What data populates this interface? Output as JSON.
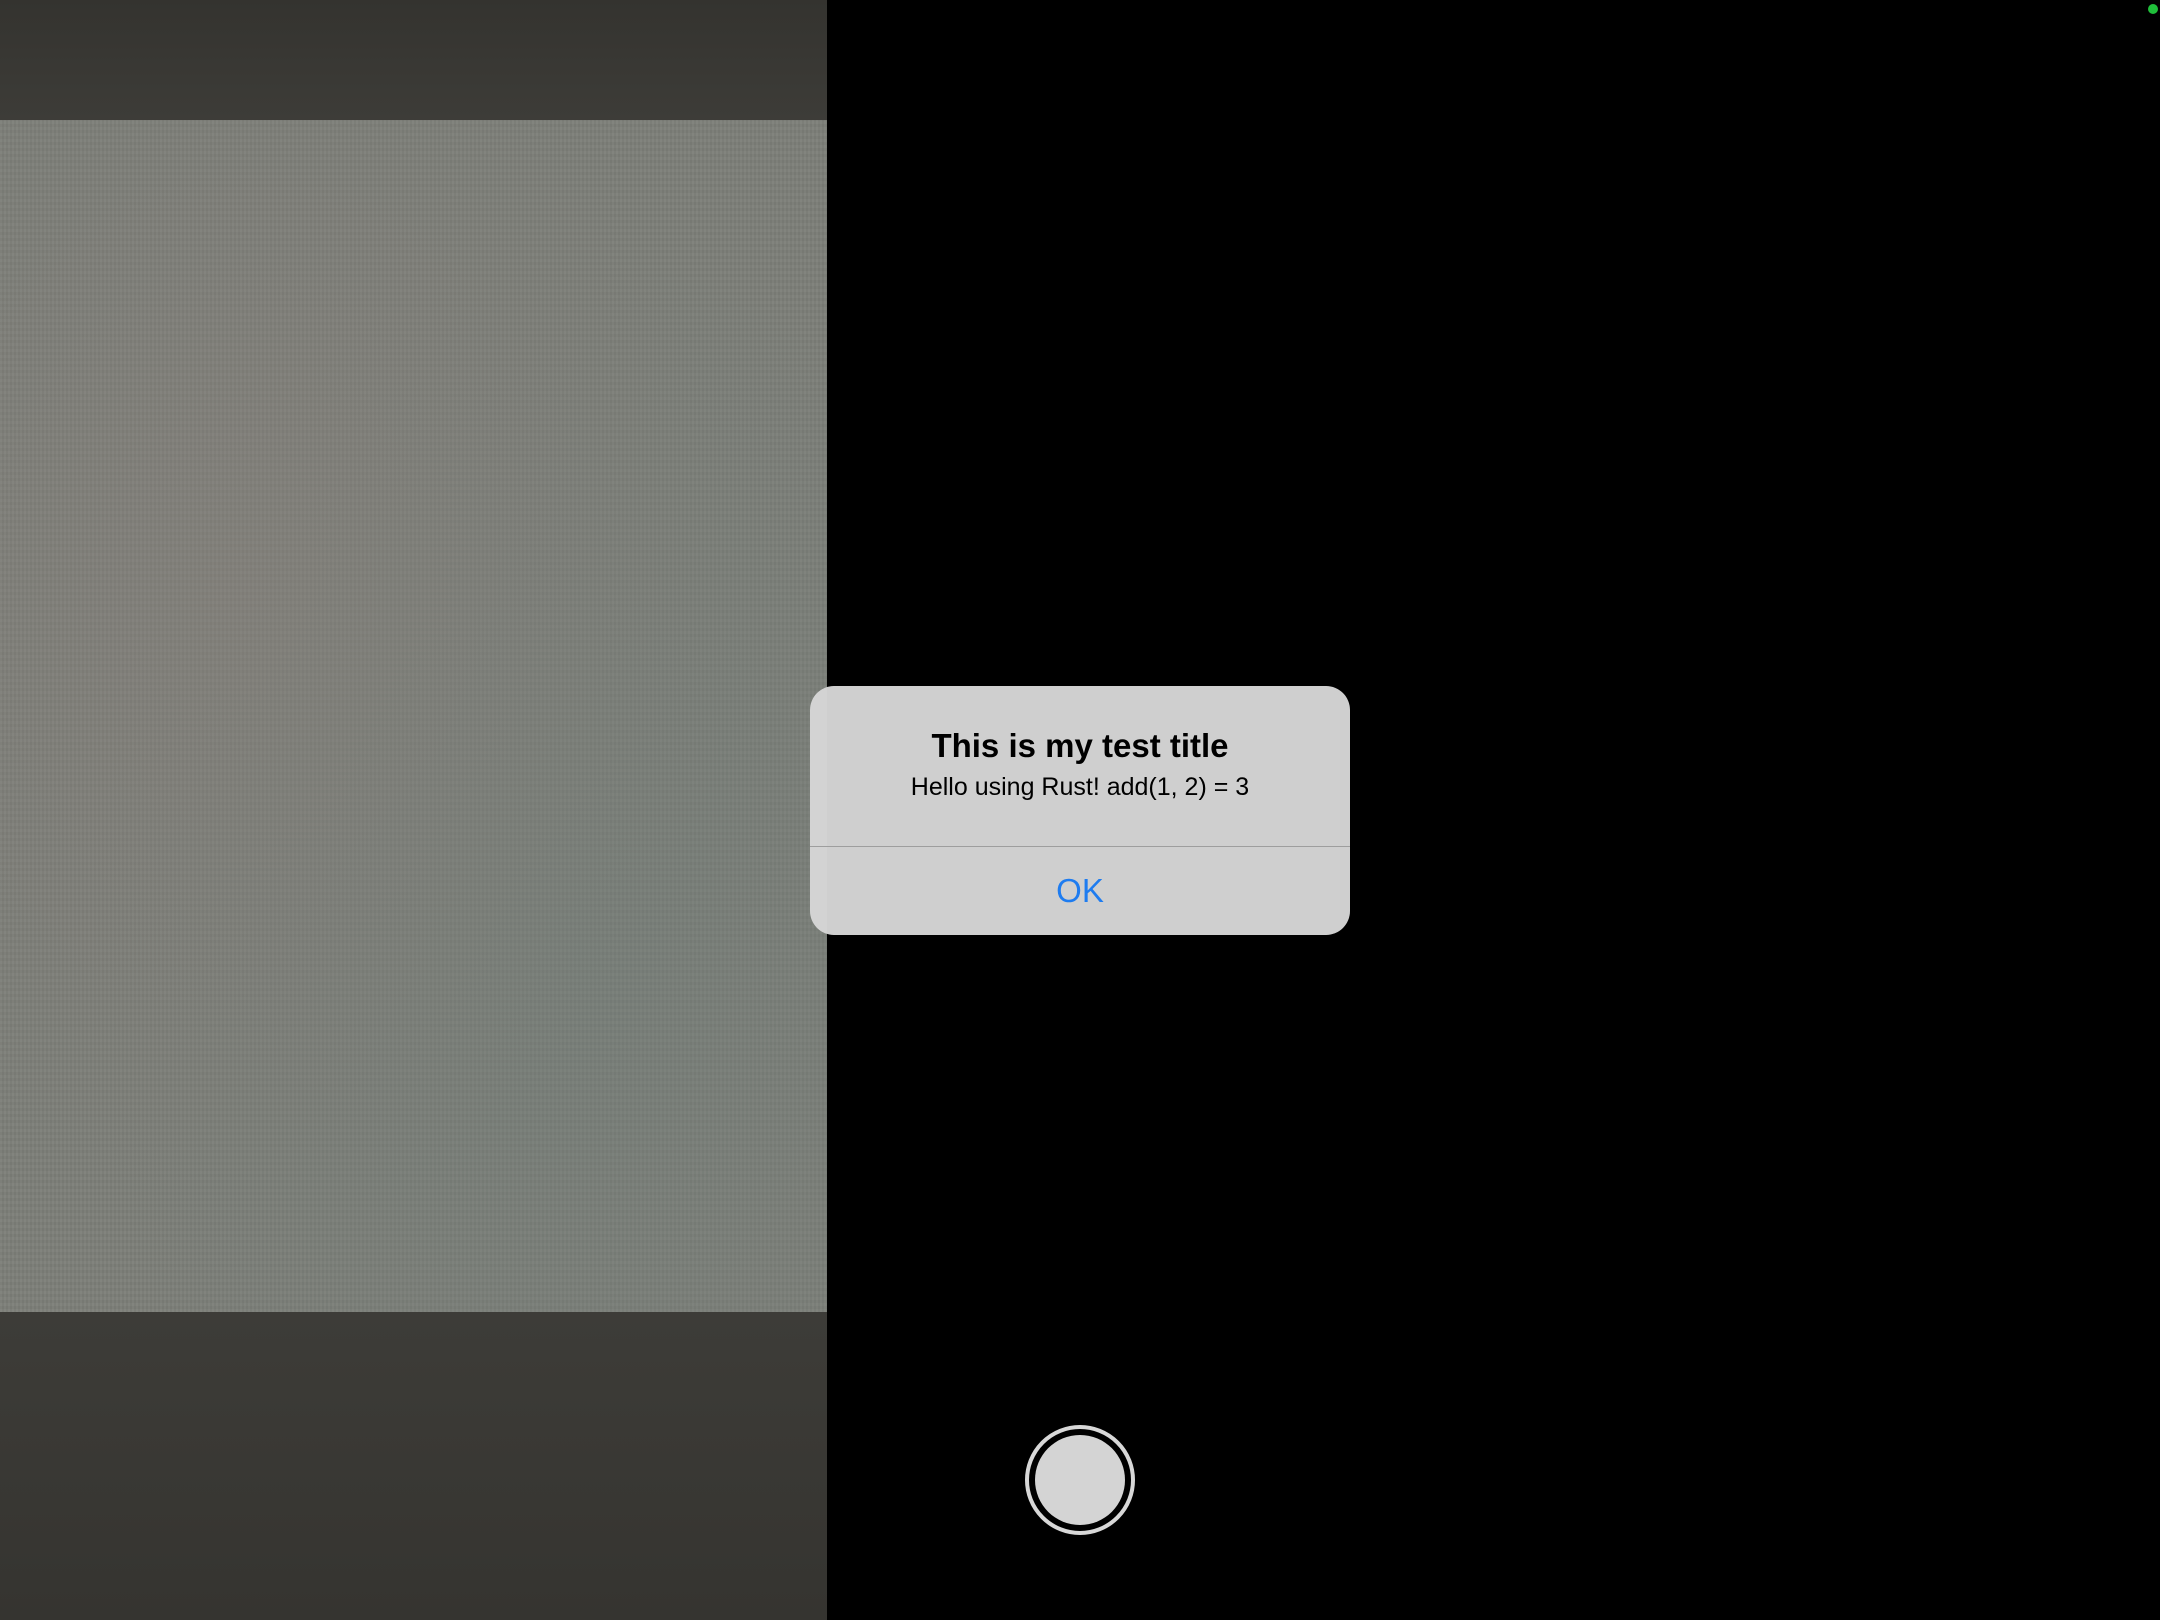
{
  "alert": {
    "title": "This is my test title",
    "message": "Hello using Rust! add(1, 2) = 3",
    "ok_label": "OK"
  },
  "colors": {
    "accent": "#1e7cf0",
    "camera_indicator": "#1fbf3a",
    "alert_background": "#d6d6d6",
    "screen_background": "#000000"
  },
  "icons": {
    "shutter": "shutter-button-icon",
    "camera_indicator": "camera-in-use-indicator-icon"
  }
}
